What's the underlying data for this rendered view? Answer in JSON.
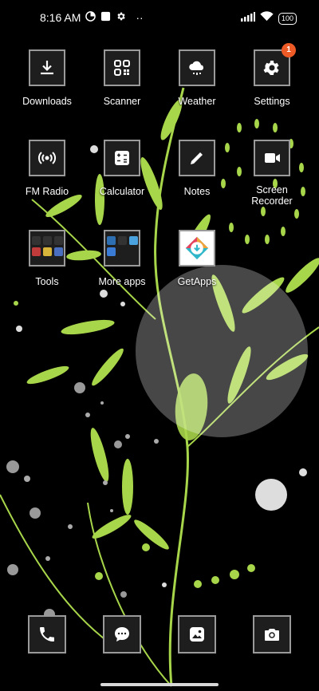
{
  "status_bar": {
    "time": "8:16 AM",
    "battery": "100",
    "icons": [
      "data-saver-icon",
      "square-icon",
      "gear-icon",
      "more-icon",
      "signal-icon",
      "wifi-icon"
    ]
  },
  "apps": [
    {
      "label": "Downloads",
      "icon": "download-icon"
    },
    {
      "label": "Scanner",
      "icon": "qr-code-icon"
    },
    {
      "label": "Weather",
      "icon": "cloud-rain-icon"
    },
    {
      "label": "Settings",
      "icon": "gear-icon",
      "badge": "1"
    },
    {
      "label": "FM Radio",
      "icon": "radio-icon"
    },
    {
      "label": "Calculator",
      "icon": "calculator-icon"
    },
    {
      "label": "Notes",
      "icon": "pencil-icon"
    },
    {
      "label": "Screen Recorder",
      "icon": "video-camera-icon"
    },
    {
      "label": "Tools",
      "icon": "folder-icon"
    },
    {
      "label": "More apps",
      "icon": "folder-icon"
    },
    {
      "label": "GetApps",
      "icon": "getapps-icon"
    }
  ],
  "dock": [
    {
      "name": "phone",
      "icon": "phone-icon"
    },
    {
      "name": "messages",
      "icon": "chat-icon"
    },
    {
      "name": "gallery",
      "icon": "gallery-icon"
    },
    {
      "name": "camera",
      "icon": "camera-icon"
    }
  ],
  "colors": {
    "accent_green": "#a8d64a",
    "badge": "#ee5b26",
    "tile_border": "#9a9a9a"
  }
}
